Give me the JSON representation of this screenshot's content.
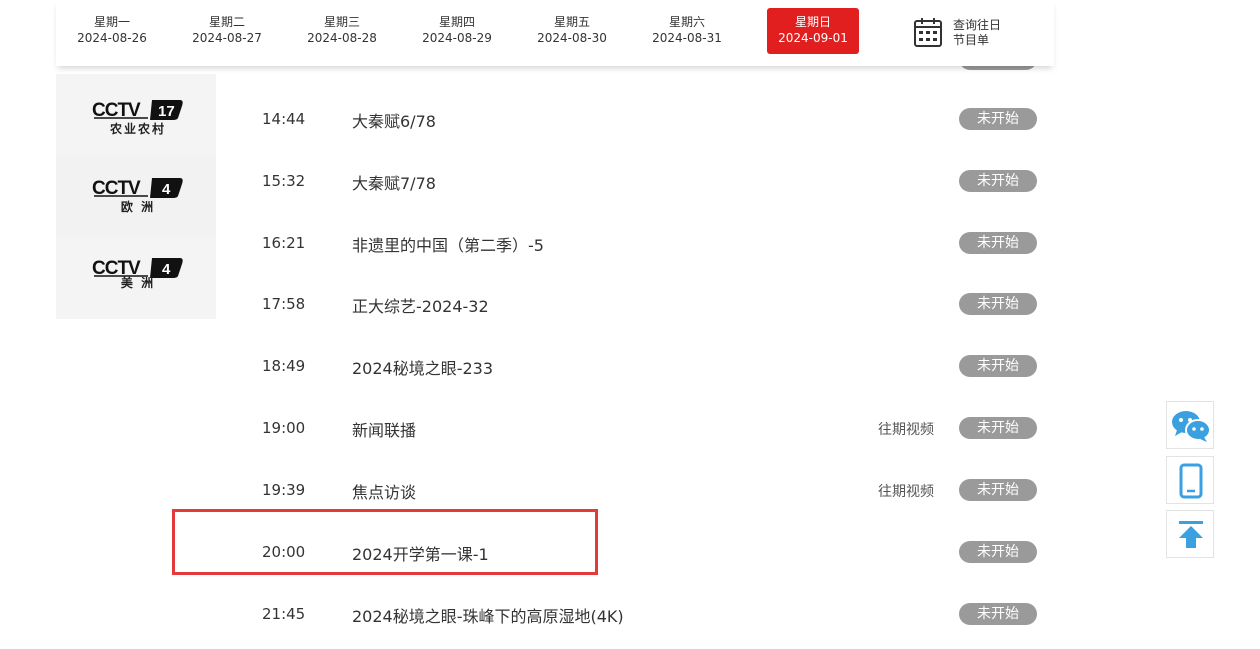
{
  "week": [
    {
      "weekday": "星期一",
      "date": "2024-08-26",
      "active": false
    },
    {
      "weekday": "星期二",
      "date": "2024-08-27",
      "active": false
    },
    {
      "weekday": "星期三",
      "date": "2024-08-28",
      "active": false
    },
    {
      "weekday": "星期四",
      "date": "2024-08-29",
      "active": false
    },
    {
      "weekday": "星期五",
      "date": "2024-08-30",
      "active": false
    },
    {
      "weekday": "星期六",
      "date": "2024-08-31",
      "active": false
    },
    {
      "weekday": "星期日",
      "date": "2024-09-01",
      "active": true
    }
  ],
  "query": {
    "line1": "查询往日",
    "line2": "节目单",
    "icon": "calendar-icon"
  },
  "channels": [
    {
      "logo_text": "CCTV",
      "number": "17",
      "sub": "农业农村",
      "icon": "cctv17-logo"
    },
    {
      "logo_text": "CCTV",
      "number": "4",
      "sub": "欧 洲",
      "icon": "cctv4-europe-logo"
    },
    {
      "logo_text": "CCTV",
      "number": "4",
      "sub": "美 洲",
      "icon": "cctv4-america-logo"
    }
  ],
  "programs": [
    {
      "time": "14:44",
      "title": "大秦赋6/78",
      "past": "",
      "status": "未开始"
    },
    {
      "time": "15:32",
      "title": "大秦赋7/78",
      "past": "",
      "status": "未开始"
    },
    {
      "time": "16:21",
      "title": "非遗里的中国（第二季）-5",
      "past": "",
      "status": "未开始"
    },
    {
      "time": "17:58",
      "title": "正大综艺-2024-32",
      "past": "",
      "status": "未开始"
    },
    {
      "time": "18:49",
      "title": "2024秘境之眼-233",
      "past": "",
      "status": "未开始"
    },
    {
      "time": "19:00",
      "title": "新闻联播",
      "past": "往期视频",
      "status": "未开始"
    },
    {
      "time": "19:39",
      "title": "焦点访谈",
      "past": "往期视频",
      "status": "未开始"
    },
    {
      "time": "20:00",
      "title": "2024开学第一课-1",
      "past": "",
      "status": "未开始"
    },
    {
      "time": "21:45",
      "title": "2024秘境之眼-珠峰下的高原湿地(4K)",
      "past": "",
      "status": "未开始"
    }
  ],
  "side_tools": [
    {
      "icon": "wechat-icon"
    },
    {
      "icon": "mobile-icon"
    },
    {
      "icon": "back-to-top-icon"
    }
  ],
  "colors": {
    "accent": "#e21f1f",
    "pill": "#9a9a9a",
    "highlight": "#e33b3b",
    "tool_blue": "#3aa0e0"
  }
}
